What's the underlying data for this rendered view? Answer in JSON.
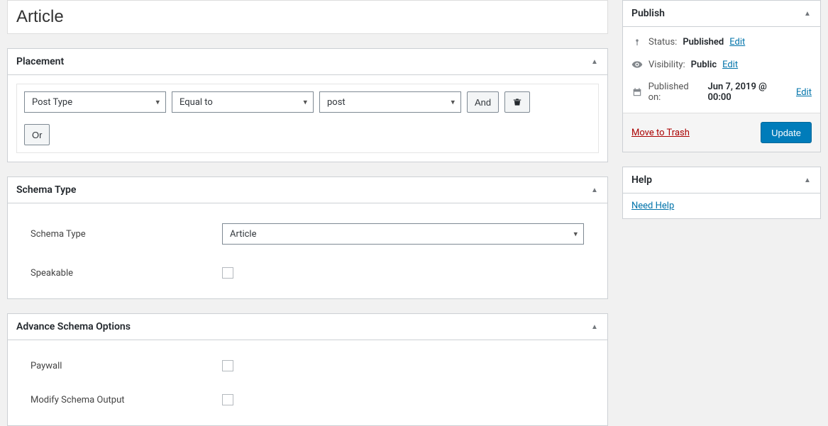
{
  "title": "Article",
  "placement": {
    "heading": "Placement",
    "rule": {
      "field": "Post Type",
      "operator": "Equal to",
      "value": "post",
      "and": "And"
    },
    "or": "Or"
  },
  "schema": {
    "heading": "Schema Type",
    "type_label": "Schema Type",
    "type_value": "Article",
    "speakable_label": "Speakable"
  },
  "advanced": {
    "heading": "Advance Schema Options",
    "paywall_label": "Paywall",
    "modify_label": "Modify Schema Output"
  },
  "publish": {
    "heading": "Publish",
    "status_label": "Status:",
    "status_value": "Published",
    "visibility_label": "Visibility:",
    "visibility_value": "Public",
    "published_label": "Published on:",
    "published_value": "Jun 7, 2019 @ 00:00",
    "edit": "Edit",
    "trash": "Move to Trash",
    "update": "Update"
  },
  "help": {
    "heading": "Help",
    "link": "Need Help"
  }
}
